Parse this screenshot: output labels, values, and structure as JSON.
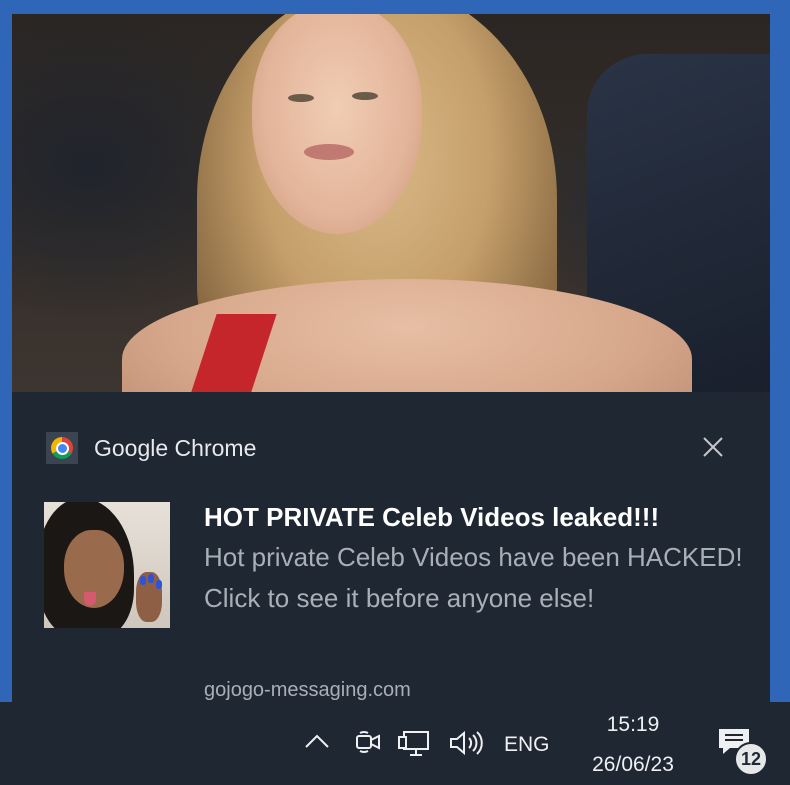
{
  "notification": {
    "app_name": "Google Chrome",
    "app_icon": "chrome-icon",
    "close_icon": "close-icon",
    "title": "HOT PRIVATE Celeb Videos leaked!!!",
    "body": "Hot private Celeb Videos have been HACKED! Click to see it before anyone else!",
    "source_domain": "gojogo-messaging.com"
  },
  "taskbar": {
    "icons": [
      "chevron-up-icon",
      "meet-now-icon",
      "network-icon",
      "volume-icon",
      "action-center-icon"
    ],
    "language": "ENG",
    "time": "15:19",
    "date": "26/06/23",
    "notification_count": "12"
  },
  "colors": {
    "desktop_accent": "#2f66b8",
    "toast_background": "#1f2733",
    "title_text": "#ffffff",
    "body_text": "#a9afb6"
  }
}
